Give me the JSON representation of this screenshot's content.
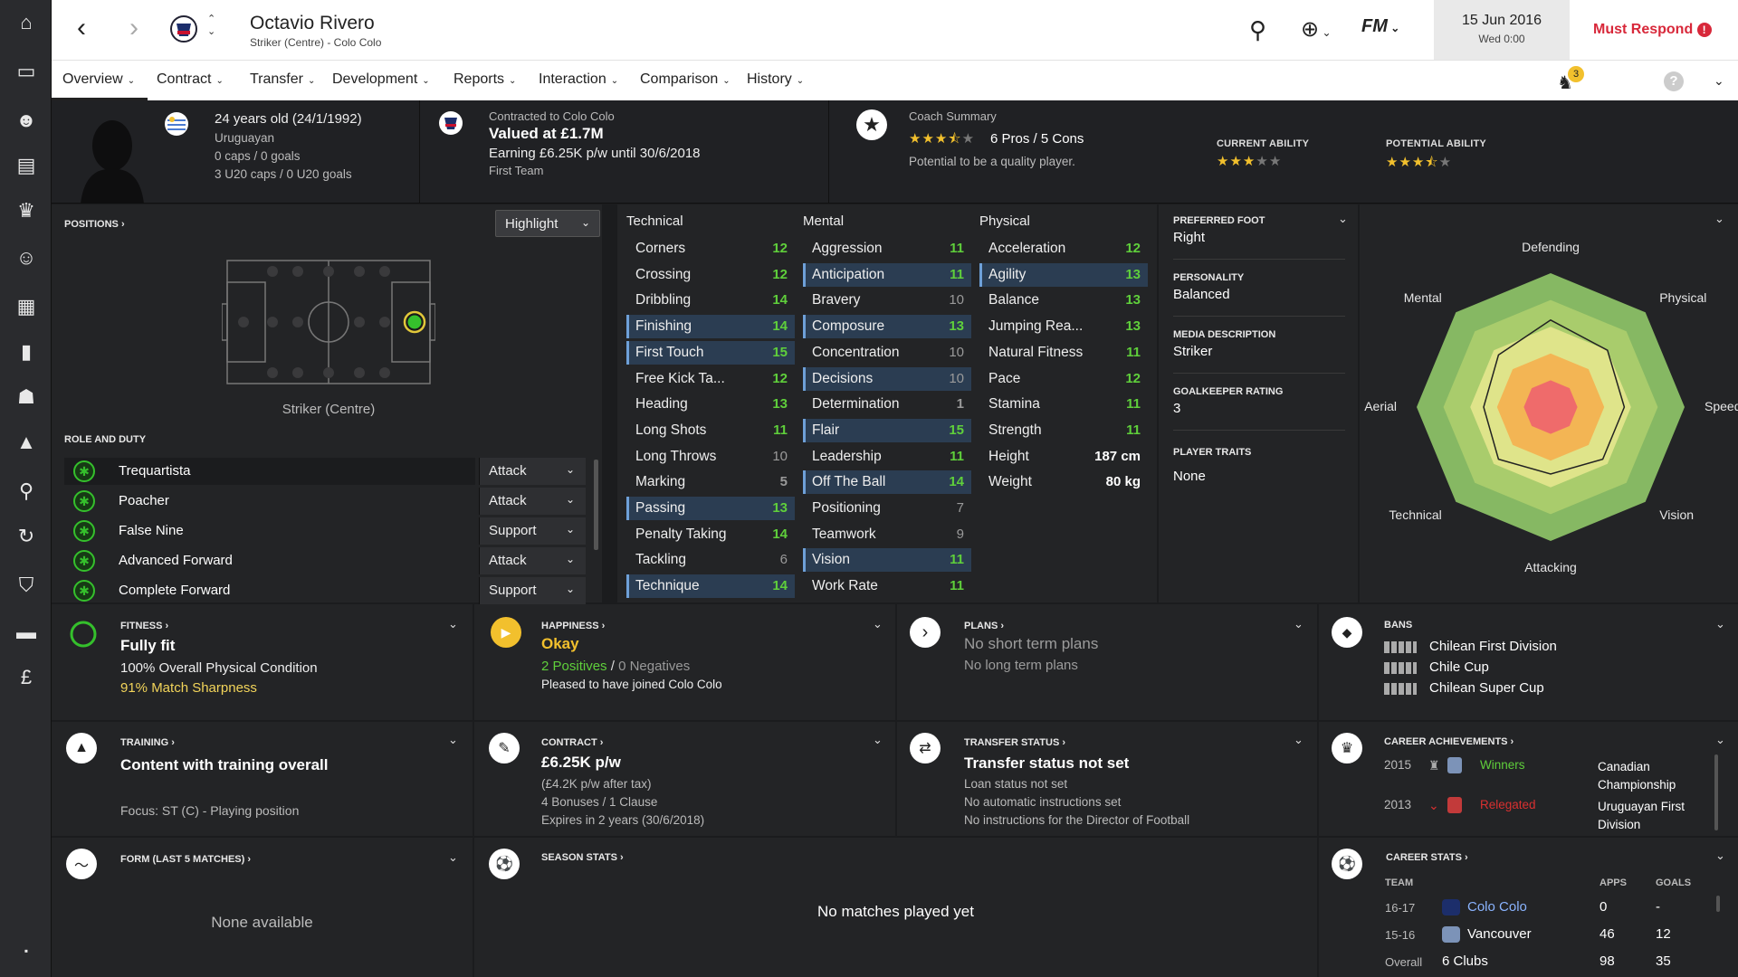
{
  "header": {
    "player_name": "Octavio Rivero",
    "subtitle": "Striker (Centre) - Colo Colo",
    "date": "15 Jun 2016",
    "time": "Wed 0:00",
    "must_respond": "Must Respond",
    "fm_label": "FM",
    "notification_count": "3"
  },
  "nav": [
    "Overview",
    "Contract",
    "Transfer",
    "Development",
    "Reports",
    "Interaction",
    "Comparison",
    "History"
  ],
  "summary": {
    "age": "24 years old (24/1/1992)",
    "nationality": "Uruguayan",
    "caps": "0 caps / 0 goals",
    "u20": "3 U20 caps / 0 U20 goals",
    "contracted": "Contracted to Colo Colo",
    "value": "Valued at £1.7M",
    "earning": "Earning £6.25K p/w until 30/6/2018",
    "squad": "First Team",
    "coach_title": "Coach Summary",
    "pros_cons": "6 Pros / 5 Cons",
    "potential_text": "Potential to be a quality player.",
    "coach_stars": 3.5,
    "ca_label": "CURRENT ABILITY",
    "ca_stars": 3,
    "pa_label": "POTENTIAL ABILITY",
    "pa_stars": 3.5
  },
  "positions": {
    "title": "POSITIONS",
    "highlight": "Highlight",
    "position_label": "Striker (Centre)"
  },
  "roles": {
    "title": "ROLE AND DUTY",
    "items": [
      {
        "role": "Trequartista",
        "duty": "Attack"
      },
      {
        "role": "Poacher",
        "duty": "Attack"
      },
      {
        "role": "False Nine",
        "duty": "Support"
      },
      {
        "role": "Advanced Forward",
        "duty": "Attack"
      },
      {
        "role": "Complete Forward",
        "duty": "Support"
      }
    ]
  },
  "attributes": {
    "technical_title": "Technical",
    "mental_title": "Mental",
    "physical_title": "Physical",
    "technical": [
      {
        "name": "Corners",
        "value": "12",
        "hl": false
      },
      {
        "name": "Crossing",
        "value": "12",
        "hl": false
      },
      {
        "name": "Dribbling",
        "value": "14",
        "hl": false
      },
      {
        "name": "Finishing",
        "value": "14",
        "hl": true
      },
      {
        "name": "First Touch",
        "value": "15",
        "hl": true
      },
      {
        "name": "Free Kick Ta...",
        "value": "12",
        "hl": false
      },
      {
        "name": "Heading",
        "value": "13",
        "hl": false
      },
      {
        "name": "Long Shots",
        "value": "11",
        "hl": false
      },
      {
        "name": "Long Throws",
        "value": "10",
        "hl": false
      },
      {
        "name": "Marking",
        "value": "5",
        "hl": false
      },
      {
        "name": "Passing",
        "value": "13",
        "hl": true
      },
      {
        "name": "Penalty Taking",
        "value": "14",
        "hl": false
      },
      {
        "name": "Tackling",
        "value": "6",
        "hl": false
      },
      {
        "name": "Technique",
        "value": "14",
        "hl": true
      }
    ],
    "mental": [
      {
        "name": "Aggression",
        "value": "11",
        "hl": false
      },
      {
        "name": "Anticipation",
        "value": "11",
        "hl": true
      },
      {
        "name": "Bravery",
        "value": "10",
        "hl": false
      },
      {
        "name": "Composure",
        "value": "13",
        "hl": true
      },
      {
        "name": "Concentration",
        "value": "10",
        "hl": false
      },
      {
        "name": "Decisions",
        "value": "10",
        "hl": true
      },
      {
        "name": "Determination",
        "value": "1",
        "hl": false
      },
      {
        "name": "Flair",
        "value": "15",
        "hl": true
      },
      {
        "name": "Leadership",
        "value": "11",
        "hl": false
      },
      {
        "name": "Off The Ball",
        "value": "14",
        "hl": true
      },
      {
        "name": "Positioning",
        "value": "7",
        "hl": false
      },
      {
        "name": "Teamwork",
        "value": "9",
        "hl": false
      },
      {
        "name": "Vision",
        "value": "11",
        "hl": true
      },
      {
        "name": "Work Rate",
        "value": "11",
        "hl": false
      }
    ],
    "physical": [
      {
        "name": "Acceleration",
        "value": "12",
        "hl": false
      },
      {
        "name": "Agility",
        "value": "13",
        "hl": true
      },
      {
        "name": "Balance",
        "value": "13",
        "hl": false
      },
      {
        "name": "Jumping Rea...",
        "value": "13",
        "hl": false
      },
      {
        "name": "Natural Fitness",
        "value": "11",
        "hl": false
      },
      {
        "name": "Pace",
        "value": "12",
        "hl": false
      },
      {
        "name": "Stamina",
        "value": "11",
        "hl": false
      },
      {
        "name": "Strength",
        "value": "11",
        "hl": false
      },
      {
        "name": "Height",
        "value": "187 cm",
        "hl": false
      },
      {
        "name": "Weight",
        "value": "80 kg",
        "hl": false
      }
    ]
  },
  "info": {
    "foot_label": "PREFERRED FOOT",
    "foot": "Right",
    "personality_label": "PERSONALITY",
    "personality": "Balanced",
    "media_label": "MEDIA DESCRIPTION",
    "media": "Striker",
    "gk_label": "GOALKEEPER RATING",
    "gk": "3",
    "traits_label": "PLAYER TRAITS",
    "traits": "None"
  },
  "radar": {
    "labels": [
      "Defending",
      "Physical",
      "Speed",
      "Vision",
      "Attacking",
      "Technical",
      "Aerial",
      "Mental"
    ],
    "values": [
      0.65,
      0.6,
      0.55,
      0.55,
      0.5,
      0.55,
      0.5,
      0.55
    ]
  },
  "fitness": {
    "title": "FITNESS",
    "status": "Fully fit",
    "line1": "100% Overall Physical Condition",
    "line2": "91% Match Sharpness"
  },
  "happiness": {
    "title": "HAPPINESS",
    "status": "Okay",
    "positives": "2 Positives",
    "sep": "/",
    "negatives": "0 Negatives",
    "note": "Pleased to have joined Colo Colo"
  },
  "plans": {
    "title": "PLANS",
    "line1": "No short term plans",
    "line2": "No long term plans"
  },
  "bans": {
    "title": "BANS",
    "items": [
      "Chilean First Division",
      "Chile Cup",
      "Chilean Super Cup"
    ]
  },
  "training": {
    "title": "TRAINING",
    "status": "Content with training overall",
    "focus": "Focus: ST (C) - Playing position"
  },
  "contract": {
    "title": "CONTRACT",
    "wage": "£6.25K p/w",
    "after_tax": "(£4.2K p/w after tax)",
    "bonuses": "4 Bonuses / 1 Clause",
    "expires": "Expires in 2 years (30/6/2018)"
  },
  "transfer": {
    "title": "TRANSFER STATUS",
    "status": "Transfer status not set",
    "line1": "Loan status not set",
    "line2": "No automatic instructions set",
    "line3": "No instructions for the Director of Football"
  },
  "achievements": {
    "title": "CAREER ACHIEVEMENTS",
    "items": [
      {
        "year": "2015",
        "result": "Winners",
        "competition": "Canadian Championship",
        "color": "#5fcf3b"
      },
      {
        "year": "2013",
        "result": "Relegated",
        "competition": "Uruguayan First Division",
        "color": "#d93030"
      }
    ]
  },
  "form": {
    "title": "FORM (LAST 5 MATCHES)",
    "empty": "None available"
  },
  "season": {
    "title": "SEASON STATS",
    "empty": "No matches played yet"
  },
  "career": {
    "title": "CAREER STATS",
    "col_team": "TEAM",
    "col_apps": "APPS",
    "col_goals": "GOALS",
    "rows": [
      {
        "season": "16-17",
        "team": "Colo Colo",
        "apps": "0",
        "goals": "-"
      },
      {
        "season": "15-16",
        "team": "Vancouver",
        "apps": "46",
        "goals": "12"
      },
      {
        "season": "Overall",
        "team": "6 Clubs",
        "apps": "98",
        "goals": "35"
      }
    ]
  }
}
